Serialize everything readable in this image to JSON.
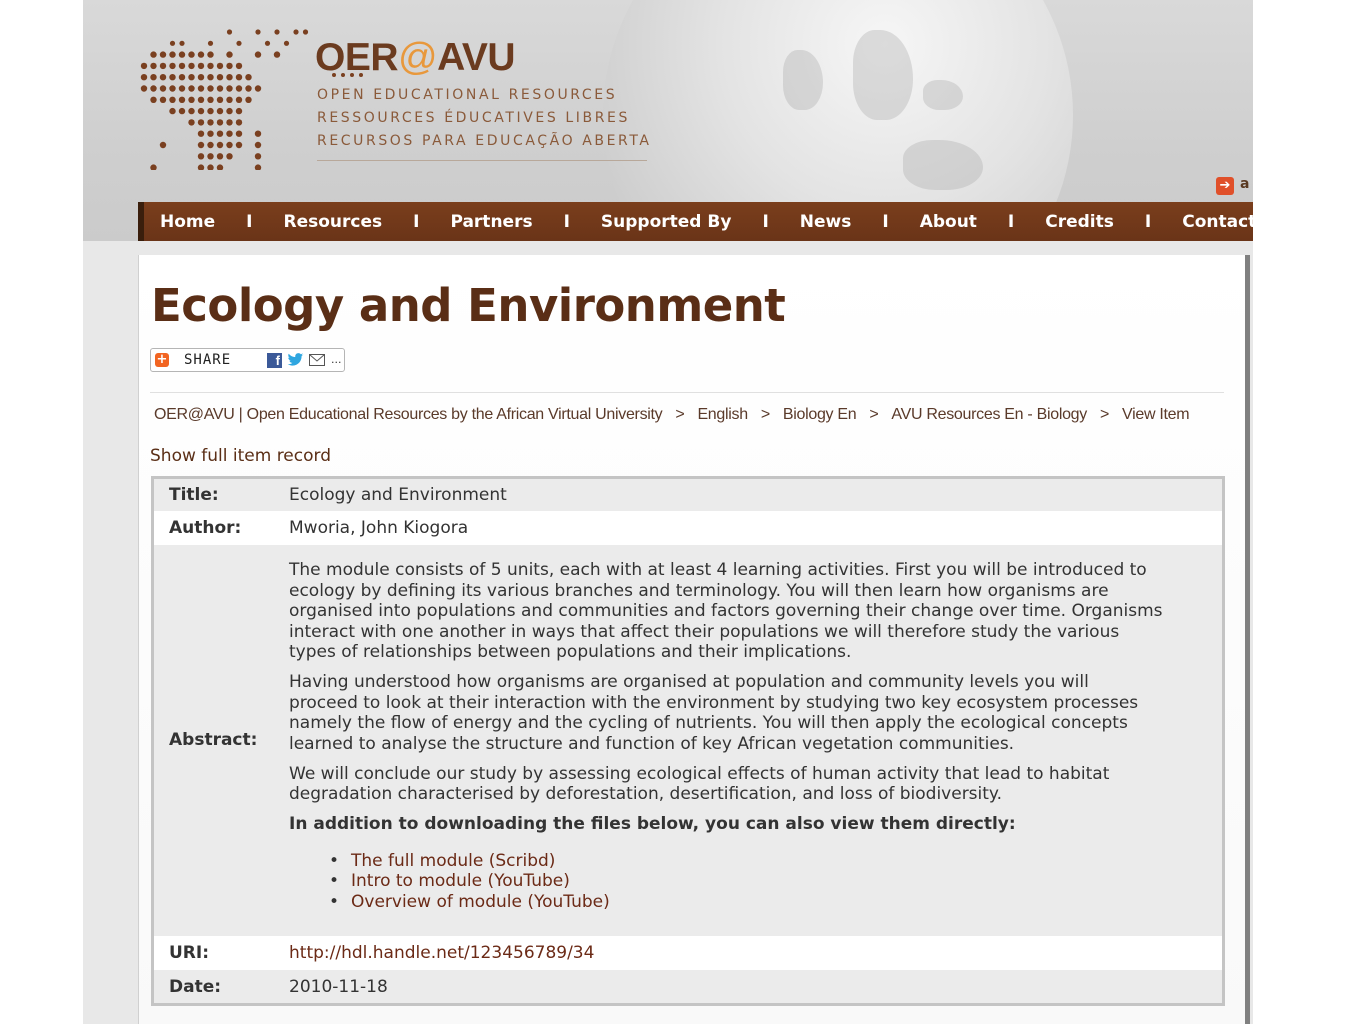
{
  "brand": {
    "name_prefix": "OER",
    "name_at": "@",
    "name_suffix": "AVU",
    "taglines": [
      "OPEN EDUCATIONAL RESOURCES",
      "RESSOURCES ÉDUCATIVES LIBRES",
      "RECURSOS PARA EDUCAÇÃO ABERTA"
    ],
    "login_partial": "a"
  },
  "nav": {
    "items": [
      "Home",
      "Resources",
      "Partners",
      "Supported By",
      "News",
      "About",
      "Credits",
      "Contact"
    ],
    "separator": "I"
  },
  "page_title": "Ecology and Environment",
  "share": {
    "label": "SHARE",
    "more": "..."
  },
  "breadcrumb": {
    "items": [
      "OER@AVU | Open Educational Resources by the African Virtual University",
      "English",
      "Biology En",
      "AVU Resources En - Biology",
      "View Item"
    ],
    "separator": ">"
  },
  "show_full_record": "Show full item record",
  "item": {
    "title_label": "Title:",
    "title": "Ecology and Environment",
    "author_label": "Author:",
    "author": "Mworia, John Kiogora",
    "abstract_label": "Abstract:",
    "abstract_lines": [
      [
        "The module consists of 5 units, each with at least 4 learning activities. First you will be introduced to",
        "ecology by defining its various branches and terminology. You will then learn how organisms are",
        "organised into populations and communities and factors governing their change over time. Organisms",
        "interact with one another in ways that affect their populations we will therefore study the various",
        "types of relationships between populations and their implications."
      ],
      [
        "Having understood how organisms are organised at population and community levels you will",
        "proceed to look at their interaction with the environment by studying two key ecosystem processes",
        "namely the flow of energy and the cycling of nutrients. You will then apply the ecological concepts",
        "learned to analyse the structure and function of key African vegetation communities."
      ],
      [
        "We will conclude our study by assessing ecological effects of human activity that lead to habitat",
        "degradation characterised by deforestation, desertification, and loss of biodiversity."
      ]
    ],
    "view_heading": "In addition to downloading the files below, you can also view them directly:",
    "view_links": [
      "The full module (Scribd)",
      "Intro to module (YouTube)",
      "Overview of module (YouTube)"
    ],
    "uri_label": "URI:",
    "uri": "http://hdl.handle.net/123456789/34",
    "date_label": "Date:",
    "date": "2010-11-18"
  },
  "colors": {
    "brand_brown": "#6b3b1f",
    "nav_bg": "#6a3418",
    "title_brown": "#5a2e16",
    "link": "#6b2a16",
    "accent_orange": "#e8983c"
  }
}
